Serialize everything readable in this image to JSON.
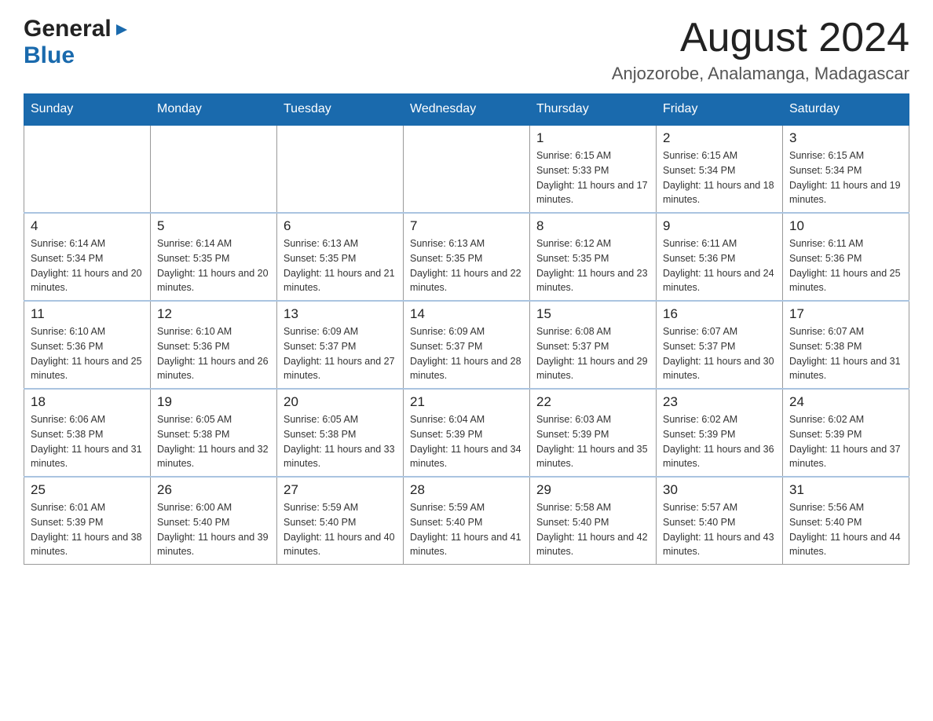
{
  "header": {
    "logo_general": "General",
    "logo_blue": "Blue",
    "title": "August 2024",
    "subtitle": "Anjozorobe, Analamanga, Madagascar"
  },
  "calendar": {
    "days_of_week": [
      "Sunday",
      "Monday",
      "Tuesday",
      "Wednesday",
      "Thursday",
      "Friday",
      "Saturday"
    ],
    "weeks": [
      {
        "cells": [
          {
            "day": "",
            "info": ""
          },
          {
            "day": "",
            "info": ""
          },
          {
            "day": "",
            "info": ""
          },
          {
            "day": "",
            "info": ""
          },
          {
            "day": "1",
            "info": "Sunrise: 6:15 AM\nSunset: 5:33 PM\nDaylight: 11 hours and 17 minutes."
          },
          {
            "day": "2",
            "info": "Sunrise: 6:15 AM\nSunset: 5:34 PM\nDaylight: 11 hours and 18 minutes."
          },
          {
            "day": "3",
            "info": "Sunrise: 6:15 AM\nSunset: 5:34 PM\nDaylight: 11 hours and 19 minutes."
          }
        ]
      },
      {
        "cells": [
          {
            "day": "4",
            "info": "Sunrise: 6:14 AM\nSunset: 5:34 PM\nDaylight: 11 hours and 20 minutes."
          },
          {
            "day": "5",
            "info": "Sunrise: 6:14 AM\nSunset: 5:35 PM\nDaylight: 11 hours and 20 minutes."
          },
          {
            "day": "6",
            "info": "Sunrise: 6:13 AM\nSunset: 5:35 PM\nDaylight: 11 hours and 21 minutes."
          },
          {
            "day": "7",
            "info": "Sunrise: 6:13 AM\nSunset: 5:35 PM\nDaylight: 11 hours and 22 minutes."
          },
          {
            "day": "8",
            "info": "Sunrise: 6:12 AM\nSunset: 5:35 PM\nDaylight: 11 hours and 23 minutes."
          },
          {
            "day": "9",
            "info": "Sunrise: 6:11 AM\nSunset: 5:36 PM\nDaylight: 11 hours and 24 minutes."
          },
          {
            "day": "10",
            "info": "Sunrise: 6:11 AM\nSunset: 5:36 PM\nDaylight: 11 hours and 25 minutes."
          }
        ]
      },
      {
        "cells": [
          {
            "day": "11",
            "info": "Sunrise: 6:10 AM\nSunset: 5:36 PM\nDaylight: 11 hours and 25 minutes."
          },
          {
            "day": "12",
            "info": "Sunrise: 6:10 AM\nSunset: 5:36 PM\nDaylight: 11 hours and 26 minutes."
          },
          {
            "day": "13",
            "info": "Sunrise: 6:09 AM\nSunset: 5:37 PM\nDaylight: 11 hours and 27 minutes."
          },
          {
            "day": "14",
            "info": "Sunrise: 6:09 AM\nSunset: 5:37 PM\nDaylight: 11 hours and 28 minutes."
          },
          {
            "day": "15",
            "info": "Sunrise: 6:08 AM\nSunset: 5:37 PM\nDaylight: 11 hours and 29 minutes."
          },
          {
            "day": "16",
            "info": "Sunrise: 6:07 AM\nSunset: 5:37 PM\nDaylight: 11 hours and 30 minutes."
          },
          {
            "day": "17",
            "info": "Sunrise: 6:07 AM\nSunset: 5:38 PM\nDaylight: 11 hours and 31 minutes."
          }
        ]
      },
      {
        "cells": [
          {
            "day": "18",
            "info": "Sunrise: 6:06 AM\nSunset: 5:38 PM\nDaylight: 11 hours and 31 minutes."
          },
          {
            "day": "19",
            "info": "Sunrise: 6:05 AM\nSunset: 5:38 PM\nDaylight: 11 hours and 32 minutes."
          },
          {
            "day": "20",
            "info": "Sunrise: 6:05 AM\nSunset: 5:38 PM\nDaylight: 11 hours and 33 minutes."
          },
          {
            "day": "21",
            "info": "Sunrise: 6:04 AM\nSunset: 5:39 PM\nDaylight: 11 hours and 34 minutes."
          },
          {
            "day": "22",
            "info": "Sunrise: 6:03 AM\nSunset: 5:39 PM\nDaylight: 11 hours and 35 minutes."
          },
          {
            "day": "23",
            "info": "Sunrise: 6:02 AM\nSunset: 5:39 PM\nDaylight: 11 hours and 36 minutes."
          },
          {
            "day": "24",
            "info": "Sunrise: 6:02 AM\nSunset: 5:39 PM\nDaylight: 11 hours and 37 minutes."
          }
        ]
      },
      {
        "cells": [
          {
            "day": "25",
            "info": "Sunrise: 6:01 AM\nSunset: 5:39 PM\nDaylight: 11 hours and 38 minutes."
          },
          {
            "day": "26",
            "info": "Sunrise: 6:00 AM\nSunset: 5:40 PM\nDaylight: 11 hours and 39 minutes."
          },
          {
            "day": "27",
            "info": "Sunrise: 5:59 AM\nSunset: 5:40 PM\nDaylight: 11 hours and 40 minutes."
          },
          {
            "day": "28",
            "info": "Sunrise: 5:59 AM\nSunset: 5:40 PM\nDaylight: 11 hours and 41 minutes."
          },
          {
            "day": "29",
            "info": "Sunrise: 5:58 AM\nSunset: 5:40 PM\nDaylight: 11 hours and 42 minutes."
          },
          {
            "day": "30",
            "info": "Sunrise: 5:57 AM\nSunset: 5:40 PM\nDaylight: 11 hours and 43 minutes."
          },
          {
            "day": "31",
            "info": "Sunrise: 5:56 AM\nSunset: 5:40 PM\nDaylight: 11 hours and 44 minutes."
          }
        ]
      }
    ]
  }
}
